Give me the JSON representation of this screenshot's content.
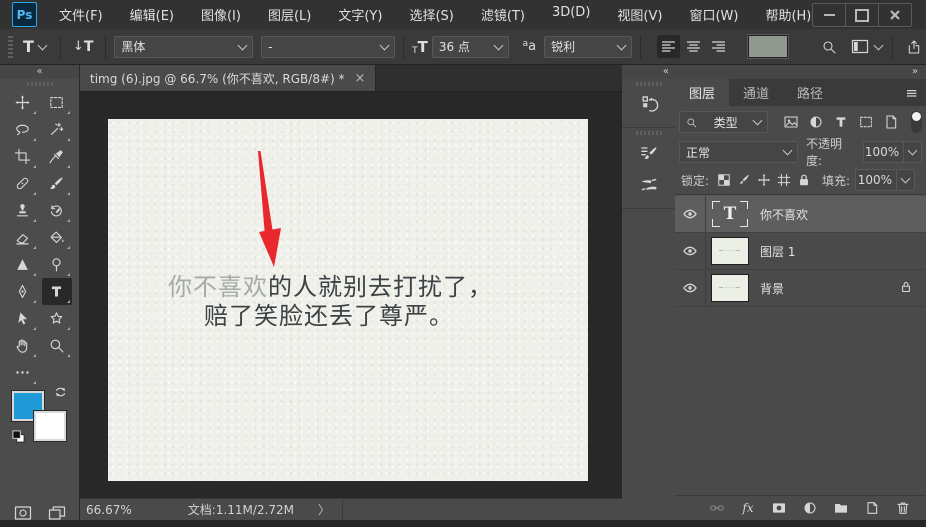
{
  "menu_bar": {
    "logo": "Ps",
    "items": [
      "文件(F)",
      "编辑(E)",
      "图像(I)",
      "图层(L)",
      "文字(Y)",
      "选择(S)",
      "滤镜(T)",
      "3D(D)",
      "视图(V)",
      "窗口(W)",
      "帮助(H)"
    ]
  },
  "options_bar": {
    "font_family": "黑体",
    "font_style": "-",
    "font_size": "36 点",
    "anti_alias": "锐利"
  },
  "icons": {
    "collapse_left": "«",
    "expand_right": "»",
    "panel_menu": "≡",
    "tab_close": "×",
    "status_chevron": "〉",
    "fx_label": "fx",
    "type_tool_glyph": "T",
    "orient_arrow": "↓",
    "size_glyph_small": "T",
    "size_glyph_large": "T",
    "aa_glyph_small": "a",
    "aa_glyph_large": "a"
  },
  "toolbar": {
    "tools": [
      {
        "id": "move"
      },
      {
        "id": "rectangular-marquee"
      },
      {
        "id": "lasso"
      },
      {
        "id": "magic-wand"
      },
      {
        "id": "crop"
      },
      {
        "id": "eyedropper"
      },
      {
        "id": "spot-healing-brush"
      },
      {
        "id": "brush"
      },
      {
        "id": "clone-stamp"
      },
      {
        "id": "history-brush"
      },
      {
        "id": "eraser"
      },
      {
        "id": "paint-bucket"
      },
      {
        "id": "sharpen"
      },
      {
        "id": "dodge"
      },
      {
        "id": "pen"
      },
      {
        "id": "horizontal-type",
        "selected": true
      },
      {
        "id": "path-selection"
      },
      {
        "id": "custom-shape"
      },
      {
        "id": "hand"
      },
      {
        "id": "zoom"
      },
      {
        "id": "more-tools"
      }
    ]
  },
  "colors": {
    "foreground": "#1f9ad6",
    "background": "#ffffff",
    "options_swatch": "#8f998f",
    "arrow_red": "#e8282d"
  },
  "document": {
    "tab_title": "timg (6).jpg @ 66.7% (你不喜欢, RGB/8#) *",
    "status_zoom": "66.67%",
    "status_doc": "文档:1.11M/2.72M",
    "canvas_text": {
      "line1_highlight": "你不喜欢",
      "line1_rest": "的人就别去打扰了，",
      "line2": "赔了笑脸还丢了尊严。"
    }
  },
  "layers_panel": {
    "tabs": [
      "图层",
      "通道",
      "路径"
    ],
    "active_tab": "图层",
    "filter_label": "类型",
    "blend_mode": "正常",
    "opacity_label": "不透明度:",
    "opacity_value": "100%",
    "lock_label": "锁定:",
    "fill_label": "填充:",
    "fill_value": "100%",
    "layers": [
      {
        "name": "你不喜欢",
        "kind": "text",
        "visible": true,
        "selected": true
      },
      {
        "name": "图层 1",
        "kind": "image",
        "visible": true
      },
      {
        "name": "背景",
        "kind": "image",
        "visible": true,
        "locked": true
      }
    ]
  }
}
